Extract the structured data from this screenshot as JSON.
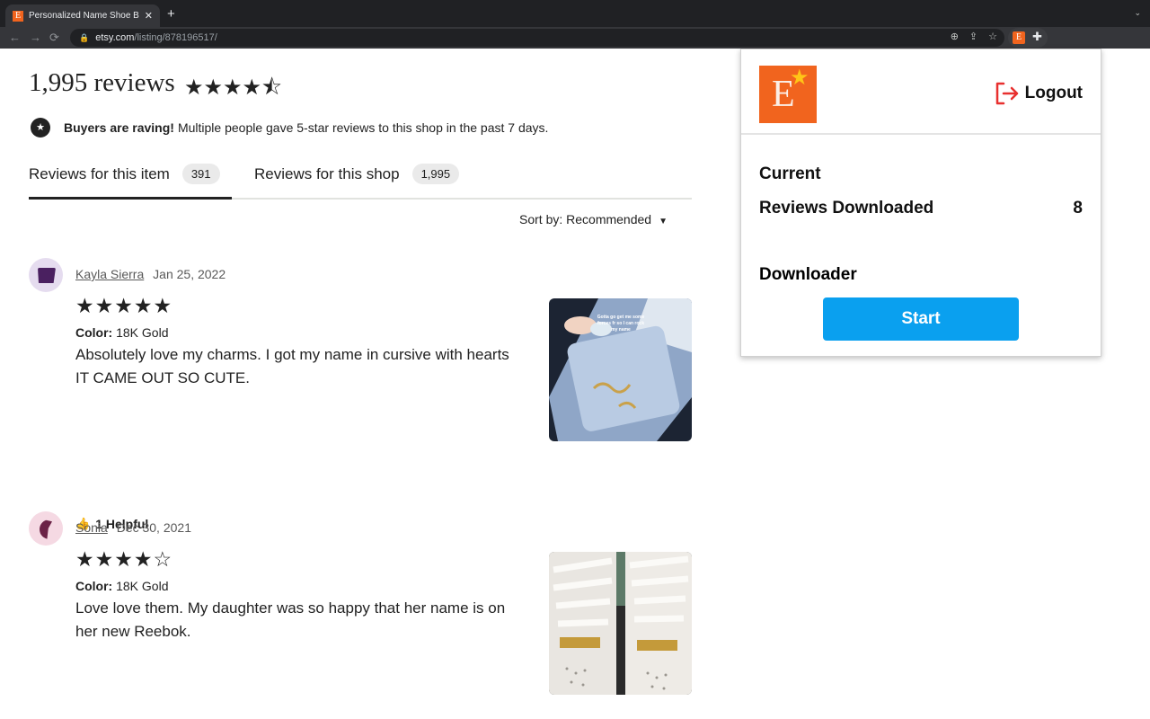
{
  "browser": {
    "tab_title": "Personalized Name Shoe Buckl",
    "tab_favicon_letter": "E",
    "new_tab_icon": "+",
    "close_icon": "✕",
    "url_host": "etsy.com",
    "url_path": "/listing/878196517/",
    "nav": {
      "back": "←",
      "forward": "→",
      "reload": "⟳"
    },
    "omni_icons": {
      "zoom": "⊕",
      "share": "⇪",
      "bookmark": "☆"
    },
    "ext_letter": "E",
    "puzzle_icon": "✚",
    "tab_menu_icon": "⌄"
  },
  "reviews_header": {
    "title": "1,995 reviews",
    "stars": "★★★★⯪",
    "rating": 4.5,
    "raving_bold": "Buyers are raving!",
    "raving_text": "Multiple people gave 5-star reviews to this shop in the past 7 days."
  },
  "tabs": [
    {
      "label": "Reviews for this item",
      "count": "391",
      "active": true
    },
    {
      "label": "Reviews for this shop",
      "count": "1,995",
      "active": false
    }
  ],
  "sort": {
    "label": "Sort by: Recommended",
    "caret": "▼"
  },
  "reviews": [
    {
      "name": "Kayla Sierra",
      "date": "Jan 25, 2022",
      "rating": 5,
      "stars": "★★★★★",
      "color_label": "Color:",
      "color_value": "18K Gold",
      "text": "Absolutely love my charms. I got my name in cursive with hearts IT CAME OUT SO CUTE.",
      "helpful": "1 Helpful",
      "photo_caption": "Gotta go get me some forces fr so I can rock my name",
      "avatar_bg": "#e5dcef",
      "avatar_fg": "#4a2060"
    },
    {
      "name": "Sonia",
      "date": "Dec 30, 2021",
      "rating": 4,
      "stars": "★★★★☆",
      "color_label": "Color:",
      "color_value": "18K Gold",
      "text": "Love love them. My daughter was so happy that her name is on her new Reebok.",
      "avatar_bg": "#f5d9e3",
      "avatar_fg": "#6b2246"
    }
  ],
  "popup": {
    "logo_letter": "E",
    "logo_star": "★",
    "logout_label": "Logout",
    "current_label": "Current",
    "reviews_downloaded_label": "Reviews Downloaded",
    "reviews_downloaded_value": "8",
    "downloader_label": "Downloader",
    "start_label": "Start",
    "colors": {
      "brand": "#f1641e",
      "accent": "#0aa0ef",
      "logout": "#e8302f"
    }
  }
}
